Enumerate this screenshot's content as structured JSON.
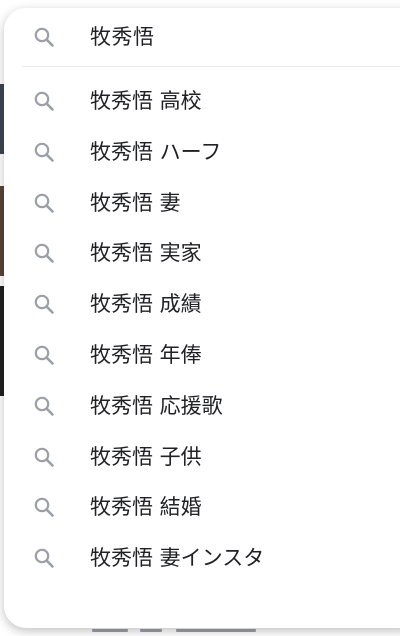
{
  "search": {
    "query": "牧秀悟",
    "icon": "search-icon"
  },
  "suggestions": [
    {
      "label": "牧秀悟 高校",
      "icon": "search-icon"
    },
    {
      "label": "牧秀悟 ハーフ",
      "icon": "search-icon"
    },
    {
      "label": "牧秀悟 妻",
      "icon": "search-icon"
    },
    {
      "label": "牧秀悟 実家",
      "icon": "search-icon"
    },
    {
      "label": "牧秀悟 成績",
      "icon": "search-icon"
    },
    {
      "label": "牧秀悟 年俸",
      "icon": "search-icon"
    },
    {
      "label": "牧秀悟 応援歌",
      "icon": "search-icon"
    },
    {
      "label": "牧秀悟 子供",
      "icon": "search-icon"
    },
    {
      "label": "牧秀悟 結婚",
      "icon": "search-icon"
    },
    {
      "label": "牧秀悟 妻インスタ",
      "icon": "search-icon"
    }
  ],
  "colors": {
    "text": "#202124",
    "icon": "#9aa0a6",
    "divider": "#e8eaed"
  }
}
